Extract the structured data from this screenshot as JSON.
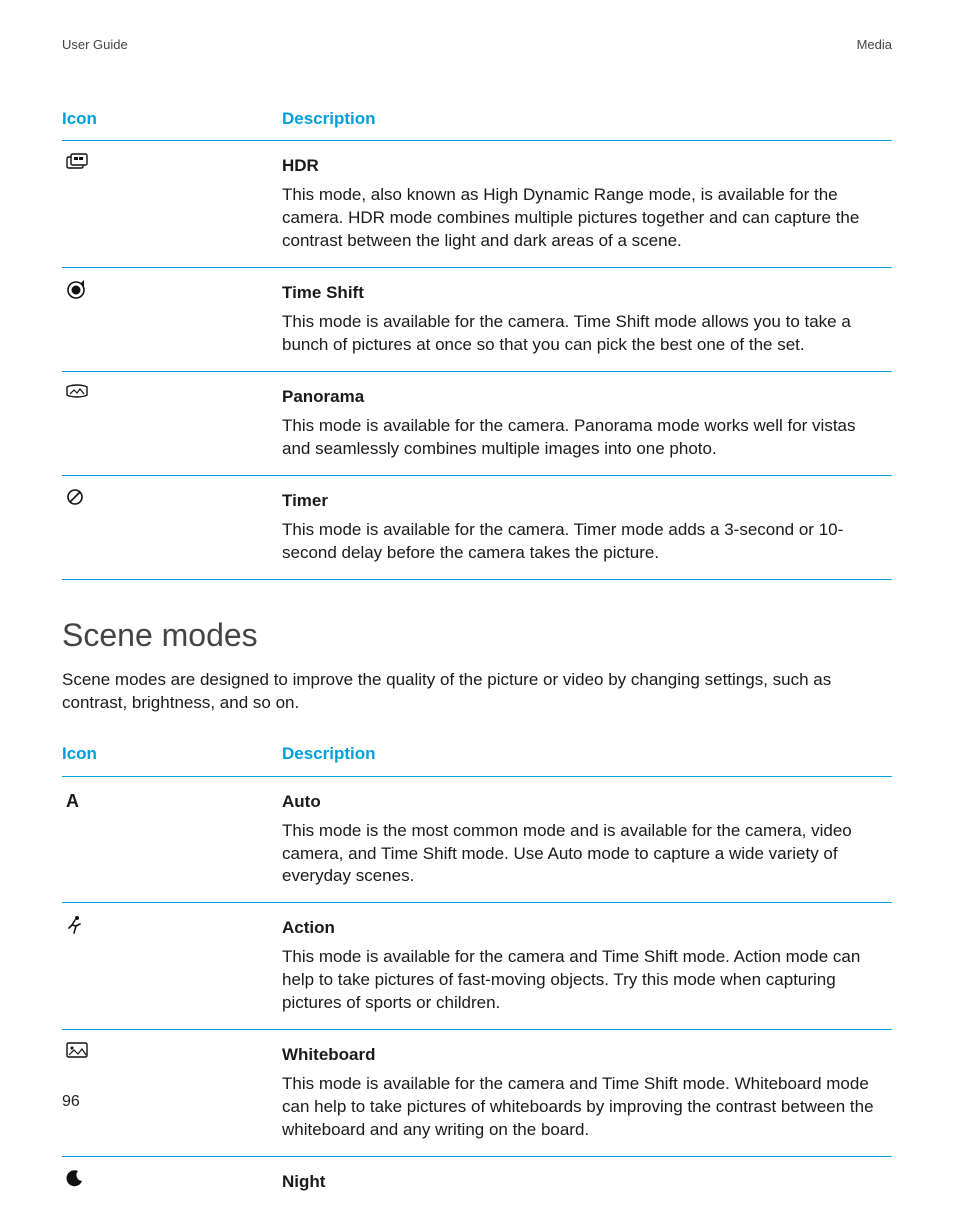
{
  "header": {
    "left": "User Guide",
    "right": "Media"
  },
  "table1": {
    "headers": {
      "icon": "Icon",
      "description": "Description"
    },
    "rows": [
      {
        "icon": "hdr-icon",
        "title": "HDR",
        "desc": "This mode, also known as High Dynamic Range mode, is available for the camera. HDR mode combines multiple pictures together and can capture the contrast between the light and dark areas of a scene."
      },
      {
        "icon": "timeshift-icon",
        "title": "Time Shift",
        "desc": "This mode is available for the camera. Time Shift mode allows you to take a bunch of pictures at once so that you can pick the best one of the set."
      },
      {
        "icon": "panorama-icon",
        "title": "Panorama",
        "desc": "This mode is available for the camera. Panorama mode works well for vistas and seamlessly combines multiple images into one photo."
      },
      {
        "icon": "timer-icon",
        "title": "Timer",
        "desc": "This mode is available for the camera. Timer mode adds a 3-second or 10-second delay before the camera takes the picture."
      }
    ]
  },
  "section": {
    "heading": "Scene modes",
    "intro": "Scene modes are designed to improve the quality of the picture or video by changing settings, such as contrast, brightness, and so on."
  },
  "table2": {
    "headers": {
      "icon": "Icon",
      "description": "Description"
    },
    "rows": [
      {
        "icon": "auto-icon",
        "title": "Auto",
        "desc": "This mode is the most common mode and is available for the camera, video camera, and Time Shift mode. Use Auto mode to capture a wide variety of everyday scenes."
      },
      {
        "icon": "action-icon",
        "title": "Action",
        "desc": "This mode is available for the camera and Time Shift mode. Action mode can help to take pictures of fast-moving objects. Try this mode when capturing pictures of sports or children."
      },
      {
        "icon": "whiteboard-icon",
        "title": "Whiteboard",
        "desc": "This mode is available for the camera and Time Shift mode. Whiteboard mode can help to take pictures of whiteboards by improving the contrast between the whiteboard and any writing on the board."
      },
      {
        "icon": "night-icon",
        "title": "Night",
        "desc": ""
      }
    ]
  },
  "footer": {
    "page_number": "96"
  },
  "icons": {
    "auto_letter": "A"
  }
}
